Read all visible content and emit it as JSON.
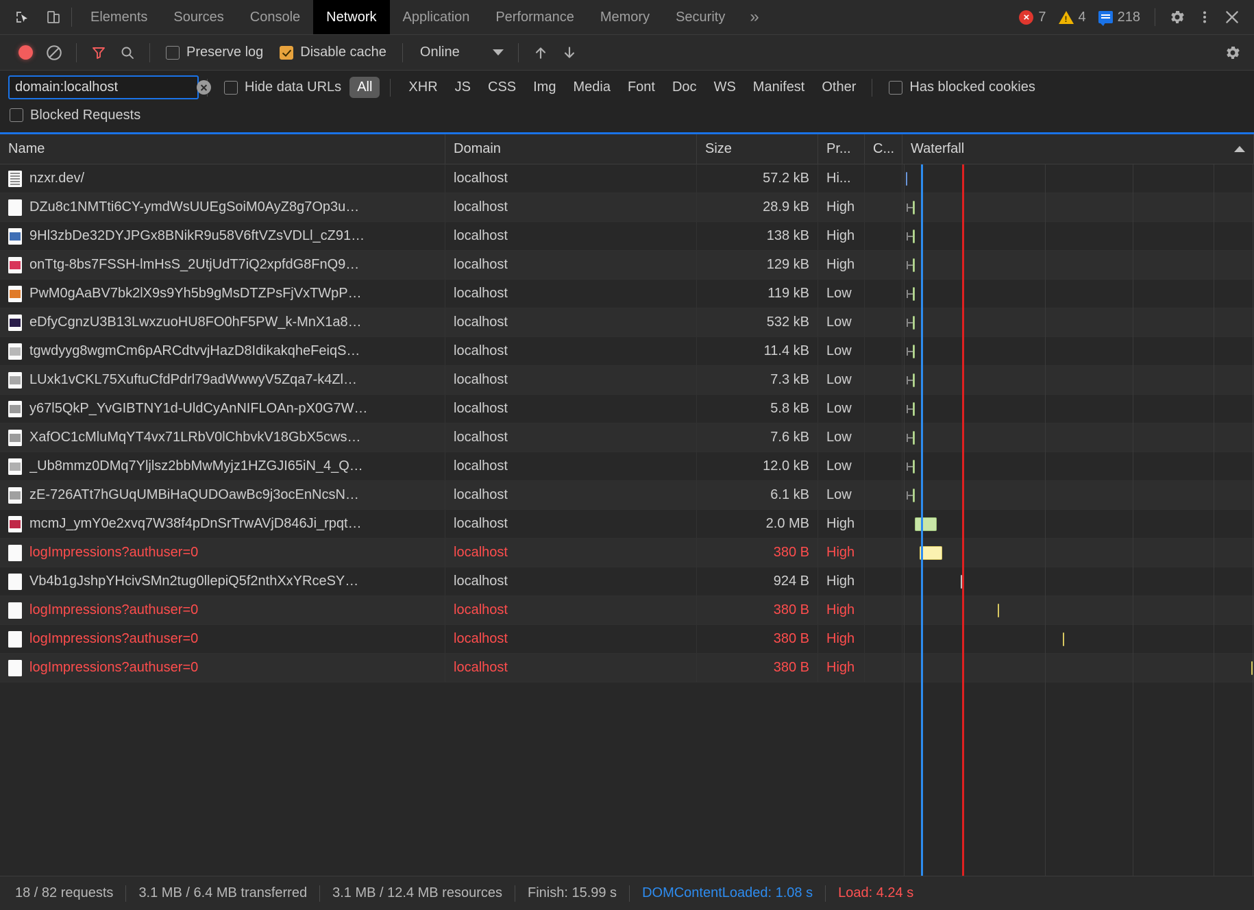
{
  "tabbar": {
    "inspect_icon": "inspect-element-icon",
    "device_icon": "device-toolbar-icon",
    "tabs": [
      {
        "label": "Elements",
        "active": false
      },
      {
        "label": "Sources",
        "active": false
      },
      {
        "label": "Console",
        "active": false
      },
      {
        "label": "Network",
        "active": true
      },
      {
        "label": "Application",
        "active": false
      },
      {
        "label": "Performance",
        "active": false
      },
      {
        "label": "Memory",
        "active": false
      },
      {
        "label": "Security",
        "active": false
      }
    ],
    "more_tabs_glyph": "»",
    "counters": {
      "errors": "7",
      "warnings": "4",
      "info": "218"
    },
    "settings_icon": "gear-icon",
    "more_icon": "kebab-menu-icon",
    "close_icon": "close-icon"
  },
  "actionbar": {
    "record_label": "record-button",
    "clear_label": "clear-button",
    "filter_label": "filter-button",
    "search_label": "search-button",
    "preserve_log": {
      "label": "Preserve log",
      "checked": false
    },
    "disable_cache": {
      "label": "Disable cache",
      "checked": true
    },
    "throttle_value": "Online",
    "import_label": "import-har-button",
    "export_label": "export-har-button",
    "settings_label": "network-settings-button"
  },
  "filterbar": {
    "search_value": "domain:localhost",
    "search_placeholder": "Filter",
    "hide_data_urls": {
      "label": "Hide data URLs",
      "checked": false
    },
    "types": [
      {
        "label": "All",
        "active": true
      },
      {
        "label": "XHR",
        "active": false
      },
      {
        "label": "JS",
        "active": false
      },
      {
        "label": "CSS",
        "active": false
      },
      {
        "label": "Img",
        "active": false
      },
      {
        "label": "Media",
        "active": false
      },
      {
        "label": "Font",
        "active": false
      },
      {
        "label": "Doc",
        "active": false
      },
      {
        "label": "WS",
        "active": false
      },
      {
        "label": "Manifest",
        "active": false
      },
      {
        "label": "Other",
        "active": false
      }
    ],
    "has_blocked_cookies": {
      "label": "Has blocked cookies",
      "checked": false
    },
    "blocked_requests": {
      "label": "Blocked Requests",
      "checked": false
    }
  },
  "table": {
    "columns": [
      {
        "key": "name",
        "label": "Name"
      },
      {
        "key": "domain",
        "label": "Domain"
      },
      {
        "key": "size",
        "label": "Size"
      },
      {
        "key": "priority",
        "label": "Pr..."
      },
      {
        "key": "connection",
        "label": "C..."
      },
      {
        "key": "waterfall",
        "label": "Waterfall"
      }
    ],
    "sort_indicator": "▲",
    "rows": [
      {
        "name": "nzxr.dev/",
        "domain": "localhost",
        "size": "57.2 kB",
        "priority": "Hi...",
        "connection": "",
        "error": false,
        "icon": "document-icon",
        "icon_kind": "doc",
        "icon_color": "#fafafa",
        "wf": {
          "start": 0.5,
          "width": 0.6,
          "color": "blue",
          "conn": 0
        }
      },
      {
        "name": "DZu8c1NMTti6CY-ymdWsUUEgSoiM0AyZ8g7Op3u…",
        "domain": "localhost",
        "size": "28.9 kB",
        "priority": "High",
        "connection": "",
        "error": false,
        "icon": "generic-file-icon",
        "icon_kind": "blank",
        "icon_color": "#fafafa",
        "wf": {
          "start": 3.2,
          "width": 1.2,
          "color": "green",
          "conn": 1.7
        }
      },
      {
        "name": "9Hl3zbDe32DYJPGx8BNikR9u58V6ftVZsVDLl_cZ91…",
        "domain": "localhost",
        "size": "138 kB",
        "priority": "High",
        "connection": "",
        "error": false,
        "icon": "image-thumbnail-icon",
        "icon_kind": "thumb",
        "icon_color": "#3f6fb5",
        "wf": {
          "start": 3.4,
          "width": 1.0,
          "color": "green",
          "conn": 1.7
        }
      },
      {
        "name": "onTtg-8bs7FSSH-lmHsS_2UtjUdT7iQ2xpfdG8FnQ9…",
        "domain": "localhost",
        "size": "129 kB",
        "priority": "High",
        "connection": "",
        "error": false,
        "icon": "image-thumbnail-icon",
        "icon_kind": "thumb",
        "icon_color": "#d8365a",
        "wf": {
          "start": 3.4,
          "width": 1.0,
          "color": "green",
          "conn": 1.7
        }
      },
      {
        "name": "PwM0gAaBV7bk2lX9s9Yh5b9gMsDTZPsFjVxTWpP…",
        "domain": "localhost",
        "size": "119 kB",
        "priority": "Low",
        "connection": "",
        "error": false,
        "icon": "image-thumbnail-icon",
        "icon_kind": "thumb",
        "icon_color": "#e07b2a"
      },
      {
        "name": "eDfyCgnzU3B13LwxzuoHU8FO0hF5PW_k-MnX1a8…",
        "domain": "localhost",
        "size": "532 kB",
        "priority": "Low",
        "connection": "",
        "error": false,
        "icon": "image-thumbnail-icon",
        "icon_kind": "thumb",
        "icon_color": "#2a1d4a"
      },
      {
        "name": "tgwdyyg8wgmCm6pARCdtvvjHazD8IdikakqheFeiqS…",
        "domain": "localhost",
        "size": "11.4 kB",
        "priority": "Low",
        "connection": "",
        "error": false,
        "icon": "image-thumbnail-icon",
        "icon_kind": "thumb",
        "icon_color": "#b8b8b8"
      },
      {
        "name": "LUxk1vCKL75XuftuCfdPdrl79adWwwyV5Zqa7-k4Zl…",
        "domain": "localhost",
        "size": "7.3 kB",
        "priority": "Low",
        "connection": "",
        "error": false,
        "icon": "image-thumbnail-icon",
        "icon_kind": "thumb",
        "icon_color": "#a8a8a8"
      },
      {
        "name": "y67l5QkP_YvGIBTNY1d-UldCyAnNIFLOAn-pX0G7W…",
        "domain": "localhost",
        "size": "5.8 kB",
        "priority": "Low",
        "connection": "",
        "error": false,
        "icon": "image-thumbnail-icon",
        "icon_kind": "thumb",
        "icon_color": "#9a9a9a"
      },
      {
        "name": "XafOC1cMluMqYT4vx71LRbV0lChbvkV18GbX5cws…",
        "domain": "localhost",
        "size": "7.6 kB",
        "priority": "Low",
        "connection": "",
        "error": false,
        "icon": "image-thumbnail-icon",
        "icon_kind": "thumb",
        "icon_color": "#9a9a9a"
      },
      {
        "name": "_Ub8mmz0DMq7Yljlsz2bbMwMyjz1HZGJI65iN_4_Q…",
        "domain": "localhost",
        "size": "12.0 kB",
        "priority": "Low",
        "connection": "",
        "error": false,
        "icon": "image-thumbnail-icon",
        "icon_kind": "thumb",
        "icon_color": "#b0b0b0"
      },
      {
        "name": "zE-726ATt7hGUqUMBiHaQUDOawBc9j3ocEnNcsN…",
        "domain": "localhost",
        "size": "6.1 kB",
        "priority": "Low",
        "connection": "",
        "error": false,
        "icon": "image-thumbnail-icon",
        "icon_kind": "thumb",
        "icon_color": "#a0a0a0"
      },
      {
        "name": "mcmJ_ymY0e2xvq7W38f4pDnSrTrwAVjD846Ji_rpqt…",
        "domain": "localhost",
        "size": "2.0 MB",
        "priority": "High",
        "connection": "",
        "error": false,
        "icon": "image-thumbnail-icon",
        "icon_kind": "thumb",
        "icon_color": "#c02848"
      },
      {
        "name": "logImpressions?authuser=0",
        "domain": "localhost",
        "size": "380 B",
        "priority": "High",
        "connection": "",
        "error": true,
        "icon": "generic-file-icon",
        "icon_kind": "blank",
        "icon_color": "#fafafa"
      },
      {
        "name": "Vb4b1gJshpYHcivSMn2tug0llepiQ5f2nthXxYRceSY…",
        "domain": "localhost",
        "size": "924 B",
        "priority": "High",
        "connection": "",
        "error": false,
        "icon": "generic-file-icon",
        "icon_kind": "blank",
        "icon_color": "#fafafa"
      },
      {
        "name": "logImpressions?authuser=0",
        "domain": "localhost",
        "size": "380 B",
        "priority": "High",
        "connection": "",
        "error": true,
        "icon": "generic-file-icon",
        "icon_kind": "blank",
        "icon_color": "#fafafa"
      },
      {
        "name": "logImpressions?authuser=0",
        "domain": "localhost",
        "size": "380 B",
        "priority": "High",
        "connection": "",
        "error": true,
        "icon": "generic-file-icon",
        "icon_kind": "blank",
        "icon_color": "#fafafa"
      },
      {
        "name": "logImpressions?authuser=0",
        "domain": "localhost",
        "size": "380 B",
        "priority": "High",
        "connection": "",
        "error": true,
        "icon": "generic-file-icon",
        "icon_kind": "blank",
        "icon_color": "#fafafa"
      }
    ]
  },
  "waterfall": {
    "dom_content_loaded_pct": 5.2,
    "load_pct": 17.0,
    "gridlines_pct": [
      0.3,
      5.2,
      17.0,
      40.5,
      65.5,
      88.5,
      99.6
    ],
    "bars": [
      {
        "row": 0,
        "left_pct": 0.9,
        "width_pct": 0.55,
        "color": "blue",
        "conn_left_pct": null
      },
      {
        "row": 1,
        "left_pct": 2.9,
        "width_pct": 0.55,
        "color": "green",
        "conn_left_pct": 1.2
      },
      {
        "row": 2,
        "left_pct": 2.9,
        "width_pct": 0.55,
        "color": "green",
        "conn_left_pct": 1.2
      },
      {
        "row": 3,
        "left_pct": 2.9,
        "width_pct": 0.55,
        "color": "green",
        "conn_left_pct": 1.2
      },
      {
        "row": 4,
        "left_pct": 2.9,
        "width_pct": 0.55,
        "color": "green",
        "conn_left_pct": 1.2
      },
      {
        "row": 5,
        "left_pct": 2.9,
        "width_pct": 0.55,
        "color": "green",
        "conn_left_pct": 1.2
      },
      {
        "row": 6,
        "left_pct": 2.9,
        "width_pct": 0.55,
        "color": "green",
        "conn_left_pct": 1.2
      },
      {
        "row": 7,
        "left_pct": 2.9,
        "width_pct": 0.55,
        "color": "green",
        "conn_left_pct": 1.2
      },
      {
        "row": 8,
        "left_pct": 2.9,
        "width_pct": 0.55,
        "color": "green",
        "conn_left_pct": 1.2
      },
      {
        "row": 9,
        "left_pct": 2.9,
        "width_pct": 0.55,
        "color": "green",
        "conn_left_pct": 1.2
      },
      {
        "row": 10,
        "left_pct": 2.9,
        "width_pct": 0.55,
        "color": "green",
        "conn_left_pct": 1.2
      },
      {
        "row": 11,
        "left_pct": 2.9,
        "width_pct": 0.55,
        "color": "green",
        "conn_left_pct": 1.2
      },
      {
        "row": 12,
        "left_pct": 3.6,
        "width_pct": 6.2,
        "color": "green",
        "conn_left_pct": null
      },
      {
        "row": 13,
        "left_pct": 4.9,
        "width_pct": 6.5,
        "color": "yellow",
        "conn_left_pct": null
      },
      {
        "row": 14,
        "left_pct": 16.5,
        "width_pct": 0.45,
        "color": "white",
        "conn_left_pct": null
      },
      {
        "row": 15,
        "left_pct": 27.1,
        "width_pct": 0.45,
        "color": "yellow",
        "conn_left_pct": null
      },
      {
        "row": 16,
        "left_pct": 45.6,
        "width_pct": 0.45,
        "color": "yellow",
        "conn_left_pct": null
      },
      {
        "row": 17,
        "left_pct": 99.2,
        "width_pct": 0.45,
        "color": "yellow",
        "conn_left_pct": null
      }
    ]
  },
  "statusbar": {
    "requests": "18 / 82 requests",
    "transferred": "3.1 MB / 6.4 MB transferred",
    "resources": "3.1 MB / 12.4 MB resources",
    "finish": "Finish: 15.99 s",
    "dom_content_loaded": "DOMContentLoaded: 1.08 s",
    "load": "Load: 4.24 s"
  },
  "colors": {
    "accent_blue": "#1a73e8",
    "error_red": "#ff4d4d",
    "load_red": "#e02020",
    "dcl_blue": "#2d8cf0",
    "bar_green": "#c8e6a7",
    "bar_yellow": "#fbf2b0",
    "checkbox_orange": "#e8a33d"
  }
}
